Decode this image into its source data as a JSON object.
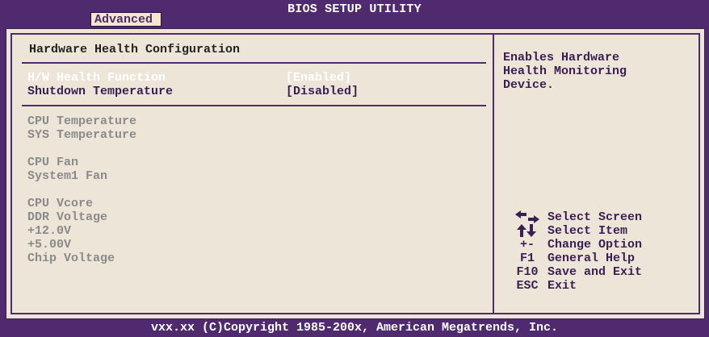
{
  "header": {
    "title": "BIOS SETUP UTILITY",
    "active_tab": "Advanced"
  },
  "main": {
    "section_title": "Hardware Health Configuration",
    "settings": [
      {
        "label": "H/W Health Function",
        "value": "[Enabled]",
        "selected": true
      },
      {
        "label": "Shutdown Temperature",
        "value": "[Disabled]",
        "selected": false
      }
    ],
    "monitors": [
      "CPU Temperature",
      "SYS Temperature",
      "CPU Fan",
      "System1 Fan",
      "CPU Vcore",
      "DDR Voltage",
      "+12.0V",
      "+5.00V",
      "Chip Voltage"
    ]
  },
  "help": {
    "text": "Enables Hardware\nHealth Monitoring\nDevice."
  },
  "legend": [
    {
      "key_icon": "left-right-arrows-icon",
      "key": "",
      "desc": "Select Screen"
    },
    {
      "key_icon": "up-down-arrows-icon",
      "key": "",
      "desc": "Select Item"
    },
    {
      "key": "+-",
      "desc": "Change Option"
    },
    {
      "key": "F1",
      "desc": "General Help"
    },
    {
      "key": "F10",
      "desc": "Save and Exit"
    },
    {
      "key": "ESC",
      "desc": "Exit"
    }
  ],
  "footer": {
    "copyright": "vxx.xx (C)Copyright 1985-200x, American Megatrends, Inc."
  },
  "colors": {
    "bar": "#4f2a6e",
    "panel": "#ede6d8",
    "selected_text": "#ffffff",
    "disabled_text": "#8a8a8a"
  }
}
